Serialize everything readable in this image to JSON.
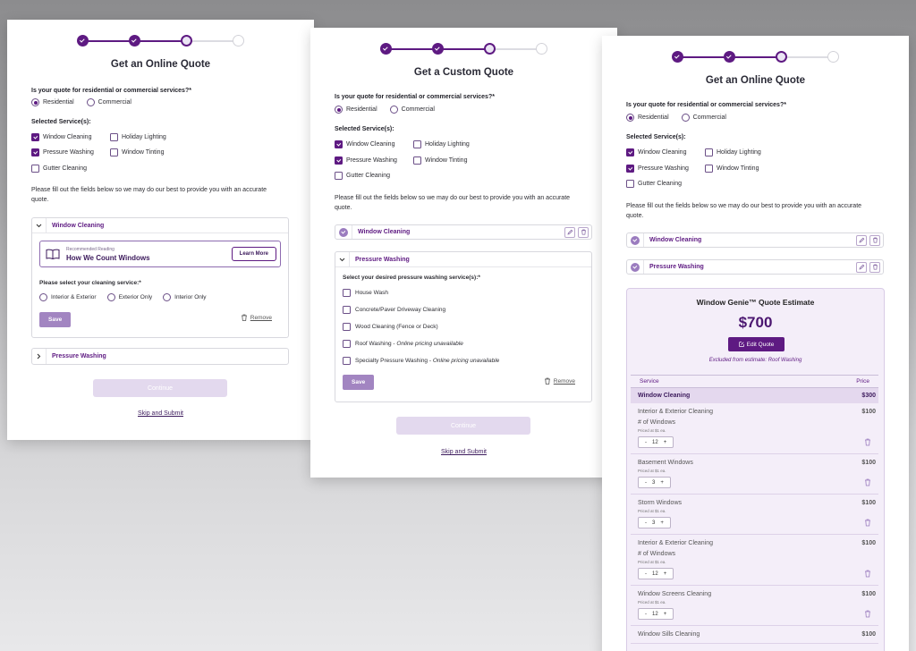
{
  "colors": {
    "brand": "#5e1a82",
    "brand_light": "#a285c1",
    "continue_disabled": "#e3d9ee",
    "estimate_bg": "#f4eef9"
  },
  "card1": {
    "title": "Get an Online Quote",
    "question": "Is your quote for residential or commercial services?*",
    "radio_residential": "Residential",
    "radio_commercial": "Commercial",
    "services_label": "Selected Service(s):",
    "services": {
      "window_cleaning": "Window Cleaning",
      "holiday_lighting": "Holiday Lighting",
      "pressure_washing": "Pressure Washing",
      "window_tinting": "Window Tinting",
      "gutter_cleaning": "Gutter Cleaning"
    },
    "instructions": "Please fill out the fields below so we may do our best to provide you with an accurate quote.",
    "accordion_window": "Window Cleaning",
    "reading_small": "Recommended Reading",
    "reading_title": "How We Count Windows",
    "learn_more": "Learn More",
    "cleaning_service_label": "Please select your cleaning service:*",
    "opt_interior_exterior": "Interior & Exterior",
    "opt_exterior_only": "Exterior Only",
    "opt_interior_only": "Interior Only",
    "save": "Save",
    "remove": "Remove",
    "accordion_pressure": "Pressure Washing",
    "continue": "Continue",
    "skip": "Skip and Submit"
  },
  "card2": {
    "title": "Get a Custom Quote",
    "question": "Is your quote for residential or commercial services?*",
    "radio_residential": "Residential",
    "radio_commercial": "Commercial",
    "services_label": "Selected Service(s):",
    "services": {
      "window_cleaning": "Window Cleaning",
      "holiday_lighting": "Holiday Lighting",
      "pressure_washing": "Pressure Washing",
      "window_tinting": "Window Tinting",
      "gutter_cleaning": "Gutter Cleaning"
    },
    "instructions": "Please fill out the fields below so we may do our best to provide you with an accurate quote.",
    "window_cleaning_done": "Window Cleaning",
    "accordion_pressure": "Pressure Washing",
    "pw_label": "Select your desired pressure washing service(s):*",
    "pw_options": [
      {
        "label": "House Wash",
        "note": ""
      },
      {
        "label": "Concrete/Paver Driveway Cleaning",
        "note": ""
      },
      {
        "label": "Wood Cleaning (Fence or Deck)",
        "note": ""
      },
      {
        "label": "Roof Washing - ",
        "note": "Online pricing unavailable"
      },
      {
        "label": "Specialty Pressure Washing - ",
        "note": "Online pricing unavailable"
      }
    ],
    "save": "Save",
    "remove": "Remove",
    "continue": "Continue",
    "skip": "Skip and Submit"
  },
  "card3": {
    "title": "Get an Online Quote",
    "question": "Is your quote for residential or commercial services?*",
    "radio_residential": "Residential",
    "radio_commercial": "Commercial",
    "services_label": "Selected Service(s):",
    "services": {
      "window_cleaning": "Window Cleaning",
      "holiday_lighting": "Holiday Lighting",
      "pressure_washing": "Pressure Washing",
      "window_tinting": "Window Tinting",
      "gutter_cleaning": "Gutter Cleaning"
    },
    "instructions": "Please fill out the fields below so we may do our best to provide you with an accurate quote.",
    "window_cleaning_done": "Window Cleaning",
    "pressure_washing_done": "Pressure Washing",
    "estimate": {
      "title": "Window Genie™ Quote Estimate",
      "total": "$700",
      "edit": "Edit Quote",
      "excluded": "Excluded from estimate: Roof Washing",
      "col_service": "Service",
      "col_price": "Price",
      "section_name": "Window Cleaning",
      "section_price": "$300",
      "items": [
        {
          "name": "Interior & Exterior Cleaning",
          "price": "$100",
          "sub": "# of Windows",
          "priced": "Priced at $1 ea.",
          "qty": "12"
        },
        {
          "name": "Basement Windows",
          "price": "$100",
          "sub": "",
          "priced": "Priced at $1 ea.",
          "qty": "3"
        },
        {
          "name": "Storm Windows",
          "price": "$100",
          "sub": "",
          "priced": "Priced at $1 ea.",
          "qty": "3"
        },
        {
          "name": "Interior & Exterior Cleaning",
          "price": "$100",
          "sub": "# of Windows",
          "priced": "Priced at $1 ea.",
          "qty": "12"
        },
        {
          "name": "Window Screens Cleaning",
          "price": "$100",
          "sub": "",
          "priced": "Priced at $1 ea.",
          "qty": "12"
        },
        {
          "name": "Window Sills Cleaning",
          "price": "$100",
          "sub": "",
          "priced": "",
          "qty": ""
        }
      ]
    }
  },
  "stepper_symbols": {
    "minus": "-",
    "plus": "+"
  },
  "chevron": {
    "down": "⌄",
    "right": "›"
  }
}
